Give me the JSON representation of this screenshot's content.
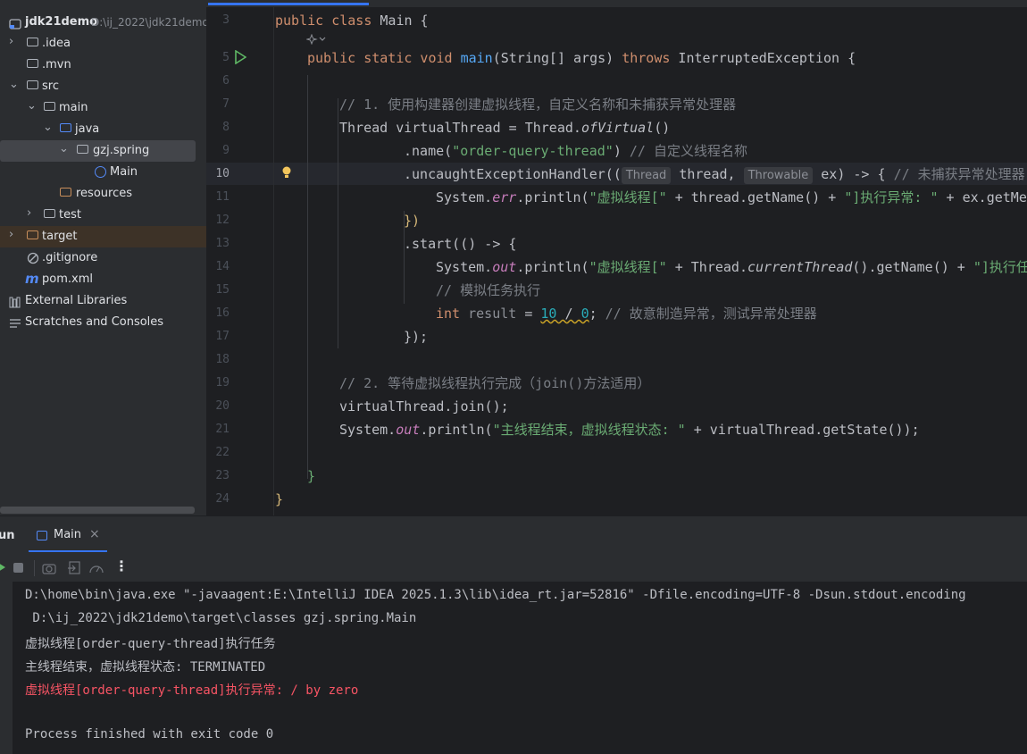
{
  "project": {
    "root_name": "jdk21demo",
    "root_path": "D:\\ij_2022\\jdk21demo",
    "items": [
      {
        "label": ".idea",
        "icon": "folder-icon"
      },
      {
        "label": ".mvn",
        "icon": "folder-icon"
      },
      {
        "label": "src",
        "icon": "folder-icon"
      },
      {
        "label": "main",
        "icon": "folder-icon"
      },
      {
        "label": "java",
        "icon": "source-folder-icon"
      },
      {
        "label": "gzj.spring",
        "icon": "package-icon"
      },
      {
        "label": "Main",
        "icon": "java-class-icon"
      },
      {
        "label": "resources",
        "icon": "resources-folder-icon"
      },
      {
        "label": "test",
        "icon": "folder-icon"
      },
      {
        "label": "target",
        "icon": "excluded-folder-icon"
      },
      {
        "label": ".gitignore",
        "icon": "ignore-file-icon"
      },
      {
        "label": "pom.xml",
        "icon": "maven-icon"
      },
      {
        "label": "External Libraries",
        "icon": "libraries-icon"
      },
      {
        "label": "Scratches and Consoles",
        "icon": "scratches-icon"
      }
    ]
  },
  "editor": {
    "line_numbers": [
      "3",
      "",
      "5",
      "6",
      "7",
      "8",
      "9",
      "10",
      "11",
      "12",
      "13",
      "14",
      "15",
      "16",
      "17",
      "18",
      "19",
      "20",
      "21",
      "22",
      "23",
      "24"
    ],
    "code": {
      "l3_kw": "public class ",
      "l3_cls": "Main",
      "l3_rest": " {",
      "l5_kw": "public static void ",
      "l5_fn": "main",
      "l5_mid": "(String[] args) ",
      "l5_kw2": "throws",
      "l5_rest": " InterruptedException {",
      "l7": "// 1. 使用构建器创建虚拟线程，自定义名称和未捕获异常处理器",
      "l8_a": "Thread virtualThread = Thread.",
      "l8_b": "ofVirtual",
      "l8_c": "()",
      "l9_a": ".name(",
      "l9_str": "\"order-query-thread\"",
      "l9_b": ") ",
      "l9_cm": "// 自定义线程名称",
      "l10_a": ".uncaughtExceptionHandler((",
      "l10_hint1": "Thread",
      "l10_b": " thread, ",
      "l10_hint2": "Throwable",
      "l10_c": " ex) -> { ",
      "l10_cm": "// 未捕获异常处理器",
      "l11_a": "System.",
      "l11_fld": "err",
      "l11_b": ".println(",
      "l11_str": "\"虚拟线程[\"",
      "l11_c": " + thread.getName() + ",
      "l11_str2": "\"]执行异常: \"",
      "l11_d": " + ex.getMes",
      "l12": "})",
      "l13": ".start(() -> {",
      "l14_a": "System.",
      "l14_fld": "out",
      "l14_b": ".println(",
      "l14_str": "\"虚拟线程[\"",
      "l14_c": " + Thread.",
      "l14_it": "currentThread",
      "l14_d": "().getName() + ",
      "l14_str2": "\"]执行任",
      "l15": "// 模拟任务执行",
      "l16_kw": "int",
      "l16_var": " result",
      "l16_a": " = ",
      "l16_n1": "10",
      "l16_b": " / ",
      "l16_n2": "0",
      "l16_c": "; ",
      "l16_cm": "// 故意制造异常，测试异常处理器",
      "l17": "});",
      "l19": "// 2. 等待虚拟线程执行完成（join()方法适用）",
      "l20": "virtualThread.join();",
      "l21_a": "System.",
      "l21_fld": "out",
      "l21_b": ".println(",
      "l21_str": "\"主线程结束，虚拟线程状态: \"",
      "l21_c": " + virtualThread.getState());",
      "l23": "}",
      "l24": "}"
    }
  },
  "run": {
    "tool_label": "Run",
    "tab_label": "Main",
    "console_lines": [
      {
        "text": "D:\\home\\bin\\java.exe \"-javaagent:E:\\IntelliJ IDEA 2025.1.3\\lib\\idea_rt.jar=52816\" -Dfile.encoding=UTF-8 -Dsun.stdout.encoding",
        "type": "normal"
      },
      {
        "text": " D:\\ij_2022\\jdk21demo\\target\\classes gzj.spring.Main",
        "type": "normal"
      },
      {
        "text": "虚拟线程[order-query-thread]执行任务",
        "type": "normal"
      },
      {
        "text": "主线程结束，虚拟线程状态: TERMINATED",
        "type": "normal"
      },
      {
        "text": "虚拟线程[order-query-thread]执行异常: / by zero",
        "type": "error"
      },
      {
        "text": "",
        "type": "normal"
      },
      {
        "text": "Process finished with exit code 0",
        "type": "normal"
      }
    ]
  },
  "colors": {
    "accent": "#3574f0",
    "error": "#f75464",
    "string": "#6aab73",
    "keyword": "#cf8e6d"
  }
}
